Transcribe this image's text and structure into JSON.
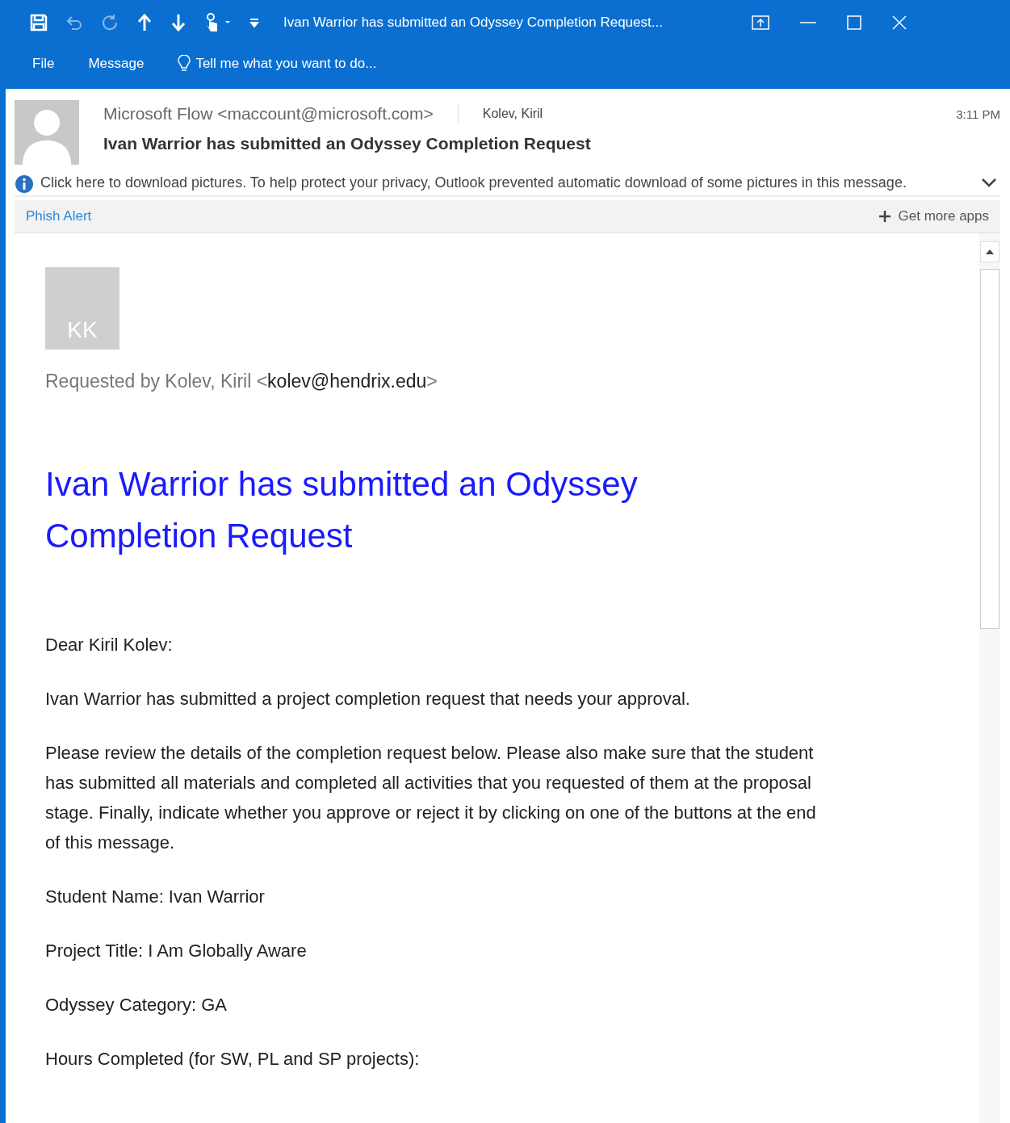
{
  "window": {
    "title": "Ivan Warrior has submitted an Odyssey Completion Request..."
  },
  "ribbon": {
    "tabs": [
      {
        "label": "File"
      },
      {
        "label": "Message"
      }
    ],
    "tell_me": {
      "placeholder": "Tell me what you want to do..."
    }
  },
  "header": {
    "from": "Microsoft Flow <maccount@microsoft.com>",
    "to": "Kolev, Kiril",
    "time": "3:11 PM",
    "subject": "Ivan Warrior has submitted an Odyssey Completion Request",
    "info": "Click here to download pictures. To help protect your privacy, Outlook prevented automatic download of some pictures in this message."
  },
  "apps_bar": {
    "app": "Phish Alert",
    "more": "Get more apps"
  },
  "message": {
    "avatar_initials": "KK",
    "requested_by": {
      "prefix": "Requested by Kolev, Kiril <",
      "email": "kolev@hendrix.edu",
      "suffix": ">"
    },
    "heading": "Ivan Warrior has submitted an Odyssey Completion Request",
    "paragraphs": [
      "Dear Kiril Kolev:",
      "Ivan Warrior has submitted a project completion request that needs your approval.",
      "Please review the details of the completion request below. Please also make sure that the student has submitted all materials and completed all activities that you requested of them at the proposal stage. Finally, indicate whether you approve or reject it by clicking on one of the buttons at the end of this message.",
      "Student Name: Ivan Warrior",
      "Project Title: I Am Globally Aware",
      "Odyssey Category: GA",
      "Hours Completed (for SW, PL and SP projects):"
    ]
  }
}
